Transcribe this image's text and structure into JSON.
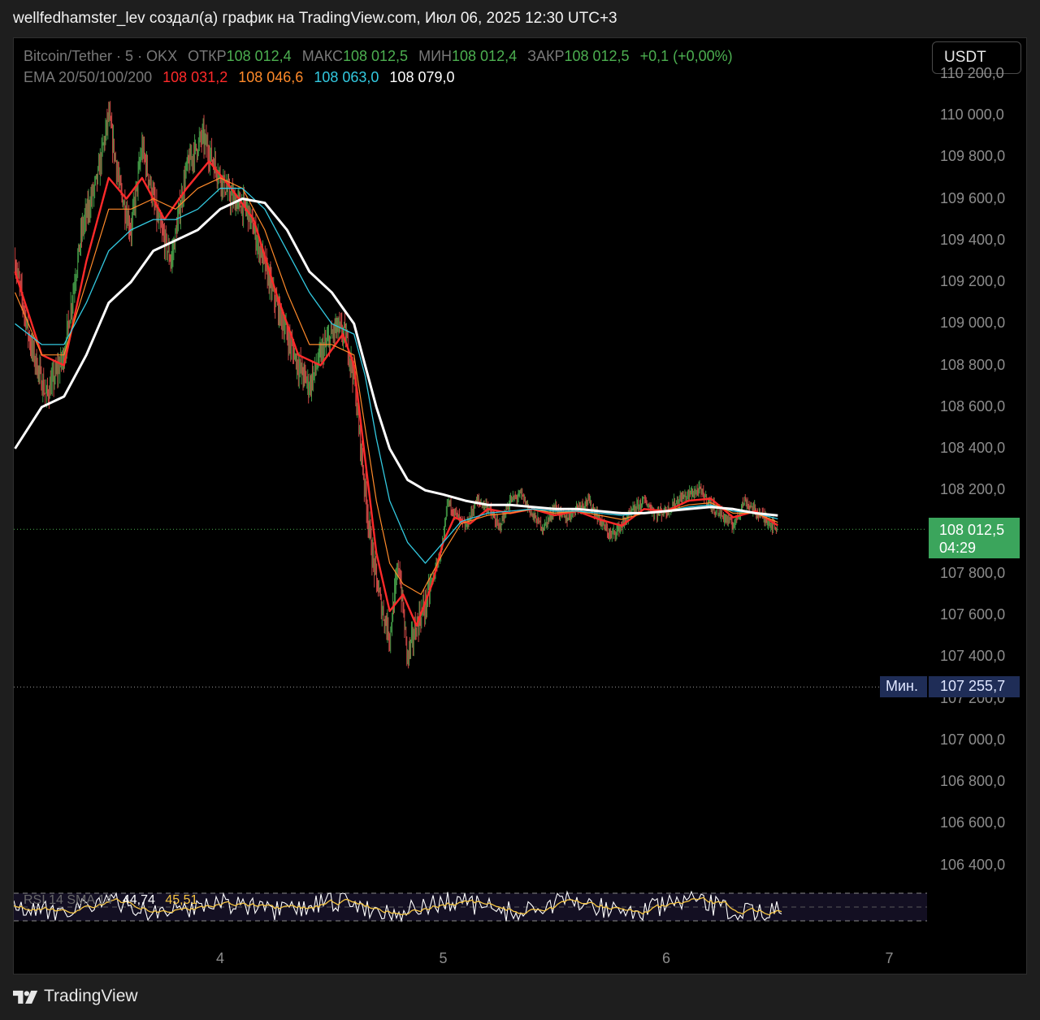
{
  "caption": "wellfedhamster_lev создал(а) график на TradingView.com, Июл 06, 2025 12:30 UTC+3",
  "symbol_line": {
    "symbol": "Bitcoin/Tether · 5 · OKX",
    "open_label": "ОТКР",
    "open": "108 012,4",
    "high_label": "МАКС",
    "high": "108 012,5",
    "low_label": "МИН",
    "low": "108 012,4",
    "close_label": "ЗАКР",
    "close": "108 012,5",
    "change": "+0,1 (+0,00%)"
  },
  "ema_line": {
    "label": "EMA 20/50/100/200",
    "ema20": "108 031,2",
    "ema50": "108 046,6",
    "ema100": "108 063,0",
    "ema200": "108 079,0"
  },
  "currency": "USDT",
  "price_badge": {
    "price": "108 012,5",
    "countdown": "04:29"
  },
  "min_marker": {
    "label": "Мин.",
    "value": "107 255,7"
  },
  "rsi_legend": {
    "label": "RSI 14 SMA 14",
    "rsi": "44,74",
    "sma": "45,51"
  },
  "footer": {
    "brand": "TradingView"
  },
  "colors": {
    "ema20": "#ff2a2a",
    "ema50": "#ff8a2a",
    "ema100": "#33c9e0",
    "ema200": "#ffffff",
    "candle_up": "#4caf50",
    "candle_down": "#ef5350",
    "price_line": "#4caf50",
    "badge": "#3ba55c",
    "min_marker": "#1f2d57"
  },
  "chart_data": {
    "type": "line",
    "title": "Bitcoin/Tether · 5 · OKX",
    "x_ticks": [
      "4",
      "5",
      "6",
      "7"
    ],
    "y_ticks": [
      "106 400,0",
      "106 600,0",
      "106 800,0",
      "107 000,0",
      "107 200,0",
      "107 400,0",
      "107 600,0",
      "107 800,0",
      "108 000,0",
      "108 200,0",
      "108 400,0",
      "108 600,0",
      "108 800,0",
      "109 000,0",
      "109 200,0",
      "109 400,0",
      "109 600,0",
      "109 800,0",
      "110 000,0",
      "110 200,0"
    ],
    "y_values": [
      106400,
      106600,
      106800,
      107000,
      107200,
      107400,
      107600,
      107800,
      108000,
      108200,
      108400,
      108600,
      108800,
      109000,
      109200,
      109400,
      109600,
      109800,
      110000,
      110200
    ],
    "ylim": [
      106200,
      110400
    ],
    "xlim": [
      3.08,
      7.05
    ],
    "last_price": 108012.5,
    "min_price": 107255.7,
    "price_path": [
      [
        3.08,
        109300
      ],
      [
        3.15,
        108900
      ],
      [
        3.22,
        108650
      ],
      [
        3.3,
        108850
      ],
      [
        3.38,
        109450
      ],
      [
        3.45,
        109700
      ],
      [
        3.5,
        110000
      ],
      [
        3.55,
        109650
      ],
      [
        3.6,
        109450
      ],
      [
        3.65,
        109850
      ],
      [
        3.72,
        109500
      ],
      [
        3.78,
        109300
      ],
      [
        3.85,
        109750
      ],
      [
        3.92,
        109900
      ],
      [
        3.98,
        109750
      ],
      [
        4.05,
        109600
      ],
      [
        4.12,
        109550
      ],
      [
        4.18,
        109350
      ],
      [
        4.25,
        109100
      ],
      [
        4.3,
        108950
      ],
      [
        4.35,
        108800
      ],
      [
        4.4,
        108700
      ],
      [
        4.45,
        108850
      ],
      [
        4.52,
        108980
      ],
      [
        4.56,
        108950
      ],
      [
        4.6,
        108750
      ],
      [
        4.64,
        108300
      ],
      [
        4.68,
        107900
      ],
      [
        4.72,
        107650
      ],
      [
        4.76,
        107500
      ],
      [
        4.8,
        107850
      ],
      [
        4.84,
        107400
      ],
      [
        4.88,
        107550
      ],
      [
        4.92,
        107650
      ],
      [
        4.96,
        107800
      ],
      [
        5.0,
        107950
      ],
      [
        5.02,
        108150
      ],
      [
        5.06,
        108080
      ],
      [
        5.1,
        108020
      ],
      [
        5.15,
        108150
      ],
      [
        5.2,
        108120
      ],
      [
        5.25,
        108020
      ],
      [
        5.3,
        108150
      ],
      [
        5.35,
        108180
      ],
      [
        5.4,
        108080
      ],
      [
        5.45,
        108020
      ],
      [
        5.5,
        108120
      ],
      [
        5.55,
        108060
      ],
      [
        5.6,
        108120
      ],
      [
        5.65,
        108150
      ],
      [
        5.7,
        108060
      ],
      [
        5.75,
        107980
      ],
      [
        5.8,
        108030
      ],
      [
        5.85,
        108100
      ],
      [
        5.9,
        108150
      ],
      [
        5.95,
        108090
      ],
      [
        6.0,
        108100
      ],
      [
        6.05,
        108150
      ],
      [
        6.1,
        108180
      ],
      [
        6.15,
        108200
      ],
      [
        6.2,
        108130
      ],
      [
        6.25,
        108080
      ],
      [
        6.3,
        108030
      ],
      [
        6.35,
        108150
      ],
      [
        6.4,
        108100
      ],
      [
        6.45,
        108060
      ],
      [
        6.5,
        108012.5
      ]
    ],
    "series": [
      {
        "name": "EMA 20",
        "values": [
          [
            3.08,
            109250
          ],
          [
            3.2,
            108850
          ],
          [
            3.3,
            108800
          ],
          [
            3.4,
            109300
          ],
          [
            3.5,
            109700
          ],
          [
            3.58,
            109600
          ],
          [
            3.65,
            109700
          ],
          [
            3.75,
            109500
          ],
          [
            3.85,
            109650
          ],
          [
            3.95,
            109780
          ],
          [
            4.05,
            109650
          ],
          [
            4.15,
            109500
          ],
          [
            4.25,
            109150
          ],
          [
            4.35,
            108850
          ],
          [
            4.45,
            108800
          ],
          [
            4.55,
            108950
          ],
          [
            4.6,
            108800
          ],
          [
            4.65,
            108350
          ],
          [
            4.7,
            107900
          ],
          [
            4.76,
            107620
          ],
          [
            4.82,
            107700
          ],
          [
            4.88,
            107550
          ],
          [
            4.95,
            107750
          ],
          [
            5.0,
            107950
          ],
          [
            5.05,
            108070
          ],
          [
            5.12,
            108040
          ],
          [
            5.2,
            108110
          ],
          [
            5.3,
            108090
          ],
          [
            5.4,
            108110
          ],
          [
            5.5,
            108080
          ],
          [
            5.6,
            108100
          ],
          [
            5.7,
            108060
          ],
          [
            5.8,
            108030
          ],
          [
            5.9,
            108110
          ],
          [
            6.0,
            108100
          ],
          [
            6.1,
            108150
          ],
          [
            6.2,
            108160
          ],
          [
            6.3,
            108070
          ],
          [
            6.4,
            108100
          ],
          [
            6.5,
            108031.2
          ]
        ]
      },
      {
        "name": "EMA 50",
        "values": [
          [
            3.08,
            109150
          ],
          [
            3.2,
            108850
          ],
          [
            3.3,
            108850
          ],
          [
            3.4,
            109200
          ],
          [
            3.5,
            109550
          ],
          [
            3.6,
            109550
          ],
          [
            3.7,
            109600
          ],
          [
            3.8,
            109550
          ],
          [
            3.9,
            109650
          ],
          [
            4.0,
            109700
          ],
          [
            4.1,
            109650
          ],
          [
            4.2,
            109450
          ],
          [
            4.3,
            109150
          ],
          [
            4.4,
            108900
          ],
          [
            4.5,
            108900
          ],
          [
            4.6,
            108850
          ],
          [
            4.65,
            108500
          ],
          [
            4.7,
            108150
          ],
          [
            4.76,
            107850
          ],
          [
            4.82,
            107750
          ],
          [
            4.9,
            107700
          ],
          [
            5.0,
            107900
          ],
          [
            5.08,
            108040
          ],
          [
            5.2,
            108080
          ],
          [
            5.3,
            108090
          ],
          [
            5.4,
            108110
          ],
          [
            5.5,
            108090
          ],
          [
            5.6,
            108100
          ],
          [
            5.7,
            108080
          ],
          [
            5.8,
            108060
          ],
          [
            5.9,
            108090
          ],
          [
            6.0,
            108100
          ],
          [
            6.1,
            108130
          ],
          [
            6.2,
            108140
          ],
          [
            6.3,
            108090
          ],
          [
            6.4,
            108090
          ],
          [
            6.5,
            108046.6
          ]
        ]
      },
      {
        "name": "EMA 100",
        "values": [
          [
            3.08,
            109000
          ],
          [
            3.2,
            108900
          ],
          [
            3.3,
            108900
          ],
          [
            3.4,
            109100
          ],
          [
            3.5,
            109350
          ],
          [
            3.6,
            109450
          ],
          [
            3.7,
            109500
          ],
          [
            3.8,
            109500
          ],
          [
            3.9,
            109550
          ],
          [
            4.0,
            109650
          ],
          [
            4.1,
            109650
          ],
          [
            4.2,
            109550
          ],
          [
            4.3,
            109350
          ],
          [
            4.4,
            109150
          ],
          [
            4.5,
            109000
          ],
          [
            4.6,
            108950
          ],
          [
            4.65,
            108750
          ],
          [
            4.7,
            108450
          ],
          [
            4.76,
            108150
          ],
          [
            4.84,
            107950
          ],
          [
            4.92,
            107850
          ],
          [
            5.0,
            107950
          ],
          [
            5.08,
            108050
          ],
          [
            5.2,
            108090
          ],
          [
            5.3,
            108100
          ],
          [
            5.4,
            108110
          ],
          [
            5.5,
            108100
          ],
          [
            5.6,
            108100
          ],
          [
            5.7,
            108090
          ],
          [
            5.8,
            108080
          ],
          [
            5.9,
            108090
          ],
          [
            6.0,
            108100
          ],
          [
            6.1,
            108120
          ],
          [
            6.2,
            108130
          ],
          [
            6.3,
            108100
          ],
          [
            6.4,
            108090
          ],
          [
            6.5,
            108063.0
          ]
        ]
      },
      {
        "name": "EMA 200",
        "values": [
          [
            3.08,
            108400
          ],
          [
            3.2,
            108600
          ],
          [
            3.3,
            108650
          ],
          [
            3.4,
            108850
          ],
          [
            3.5,
            109100
          ],
          [
            3.6,
            109200
          ],
          [
            3.7,
            109350
          ],
          [
            3.8,
            109400
          ],
          [
            3.9,
            109450
          ],
          [
            4.0,
            109550
          ],
          [
            4.1,
            109600
          ],
          [
            4.2,
            109580
          ],
          [
            4.3,
            109450
          ],
          [
            4.4,
            109250
          ],
          [
            4.5,
            109150
          ],
          [
            4.6,
            109000
          ],
          [
            4.65,
            108800
          ],
          [
            4.7,
            108600
          ],
          [
            4.76,
            108400
          ],
          [
            4.84,
            108250
          ],
          [
            4.92,
            108200
          ],
          [
            5.0,
            108180
          ],
          [
            5.1,
            108150
          ],
          [
            5.2,
            108130
          ],
          [
            5.3,
            108130
          ],
          [
            5.4,
            108120
          ],
          [
            5.5,
            108110
          ],
          [
            5.6,
            108110
          ],
          [
            5.7,
            108100
          ],
          [
            5.8,
            108090
          ],
          [
            5.9,
            108090
          ],
          [
            6.0,
            108100
          ],
          [
            6.1,
            108110
          ],
          [
            6.2,
            108120
          ],
          [
            6.3,
            108110
          ],
          [
            6.4,
            108090
          ],
          [
            6.5,
            108079.0
          ]
        ]
      }
    ]
  }
}
